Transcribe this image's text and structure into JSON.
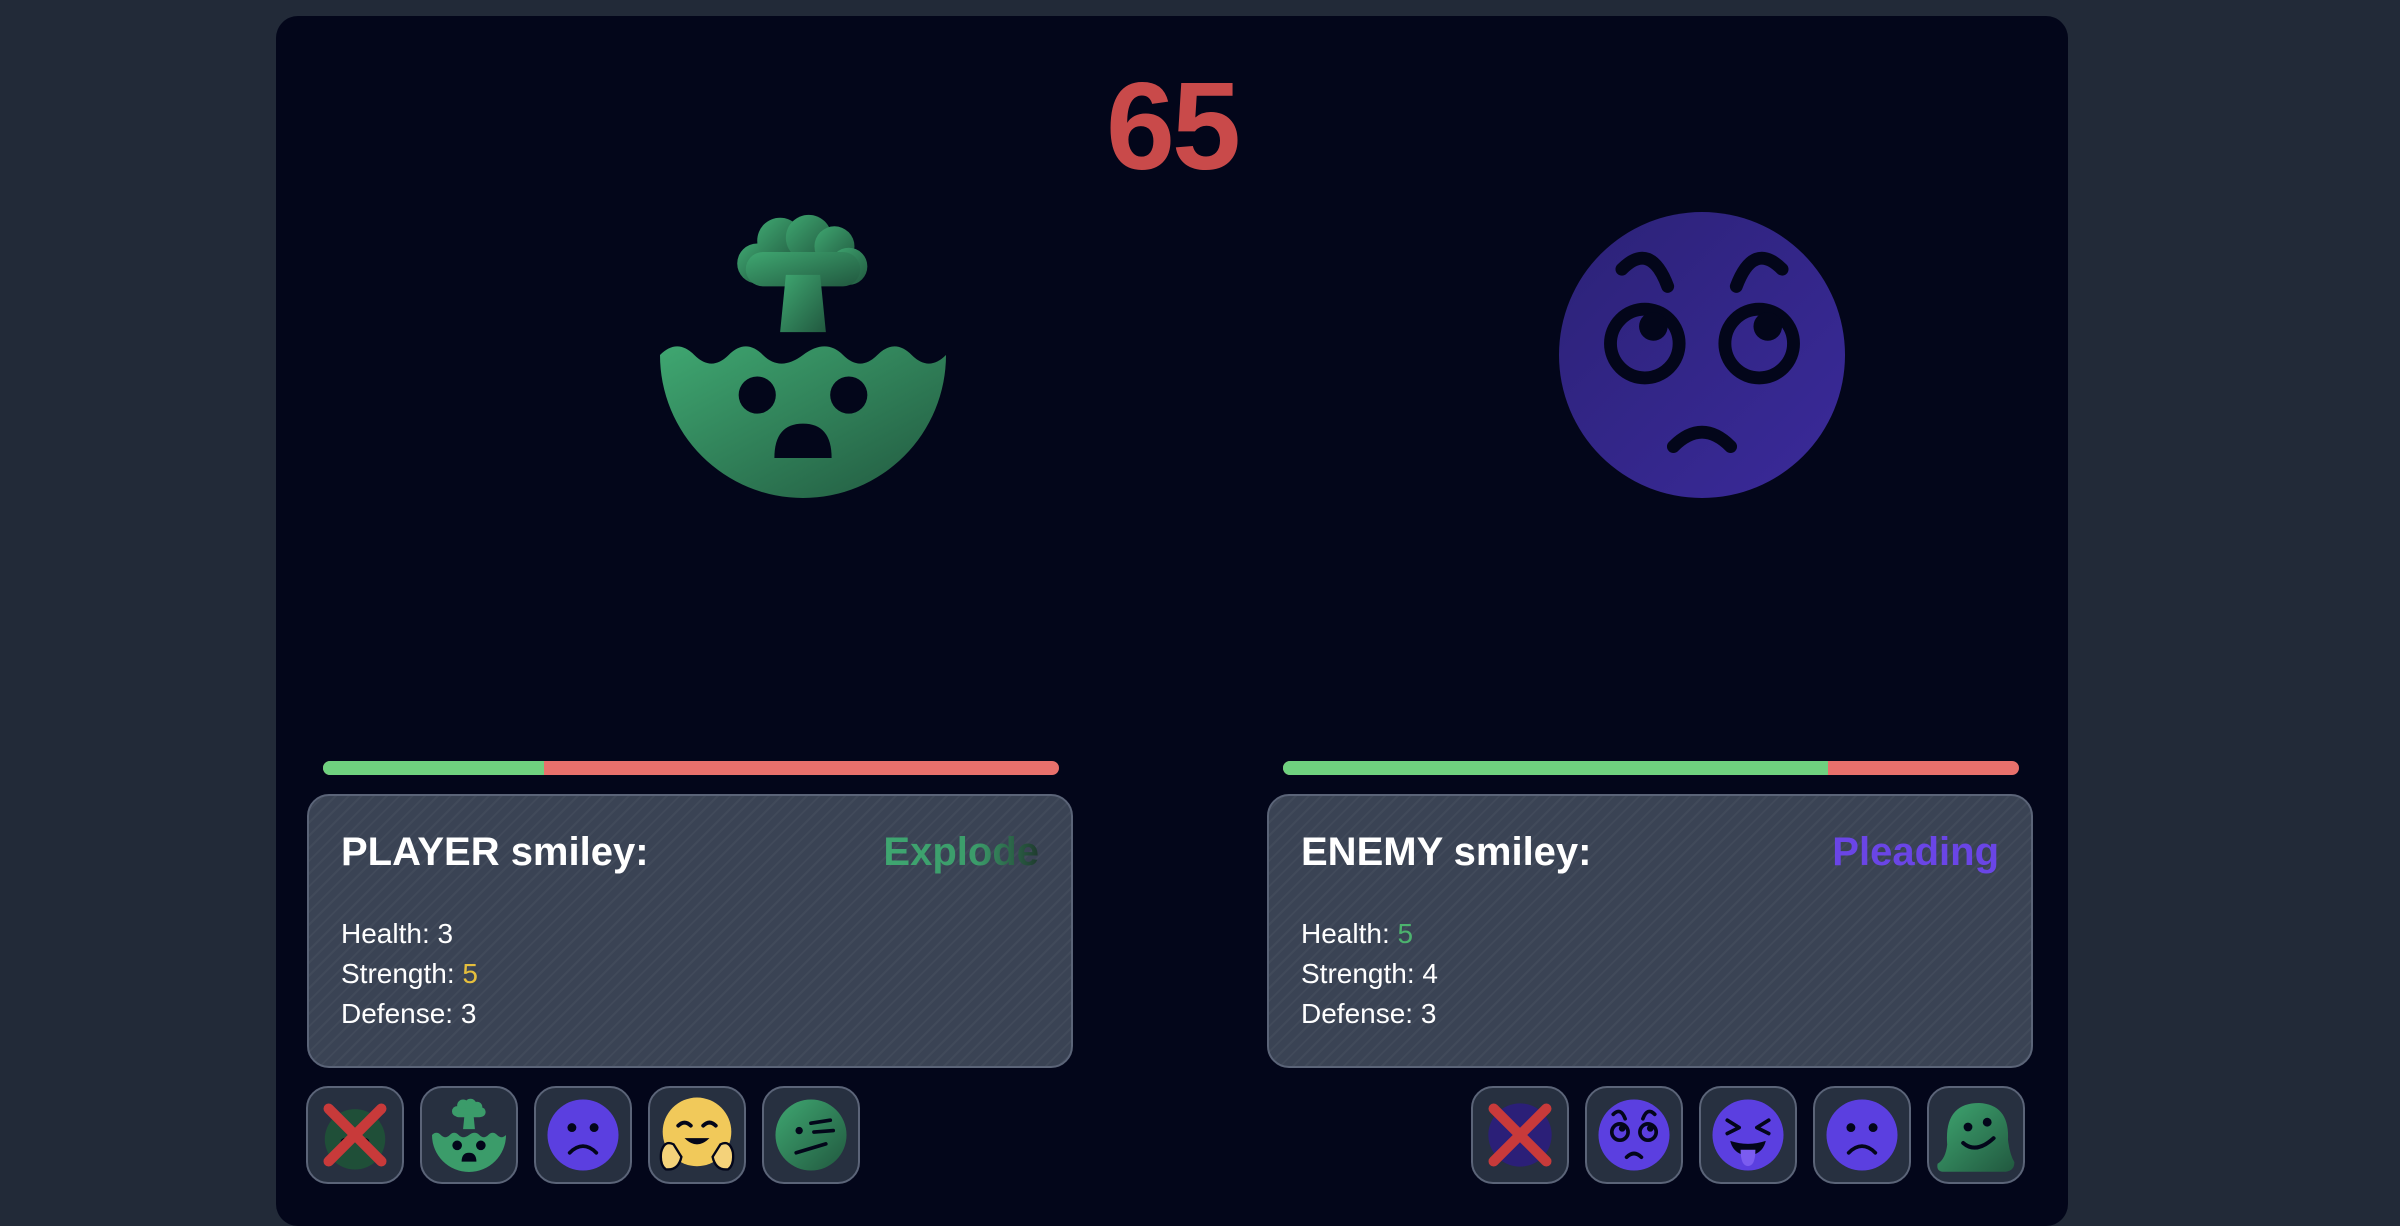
{
  "timer": "65",
  "player": {
    "title": "PLAYER smiley:",
    "type": "Explode",
    "health_label": "Health:",
    "health": "3",
    "strength_label": "Strength:",
    "strength": "5",
    "defense_label": "Defense:",
    "defense": "3",
    "hp_fraction": 0.3,
    "smiley_icon": "exploding-head",
    "team": [
      "exploding-head-defeated",
      "exploding-head",
      "frowning-face",
      "hugging-face",
      "face-with-diagonal-mouth"
    ]
  },
  "enemy": {
    "title": "ENEMY smiley:",
    "type": "Pleading",
    "health_label": "Health:",
    "health": "5",
    "strength_label": "Strength:",
    "strength": "4",
    "defense_label": "Defense:",
    "defense": "3",
    "hp_fraction": 0.74,
    "smiley_icon": "pleading-face",
    "team": [
      "pleading-face-defeated",
      "pleading-face",
      "squinting-tongue-face",
      "frowning-face",
      "melting-face"
    ]
  },
  "colors": {
    "hp_good": "#6fd17f",
    "hp_bad": "#e8706c",
    "timer": "#c94a4a",
    "green_smiley": "#3b9c6a",
    "purple_smiley": "#5a3ed6",
    "yellow_smiley": "#f1c95a"
  }
}
